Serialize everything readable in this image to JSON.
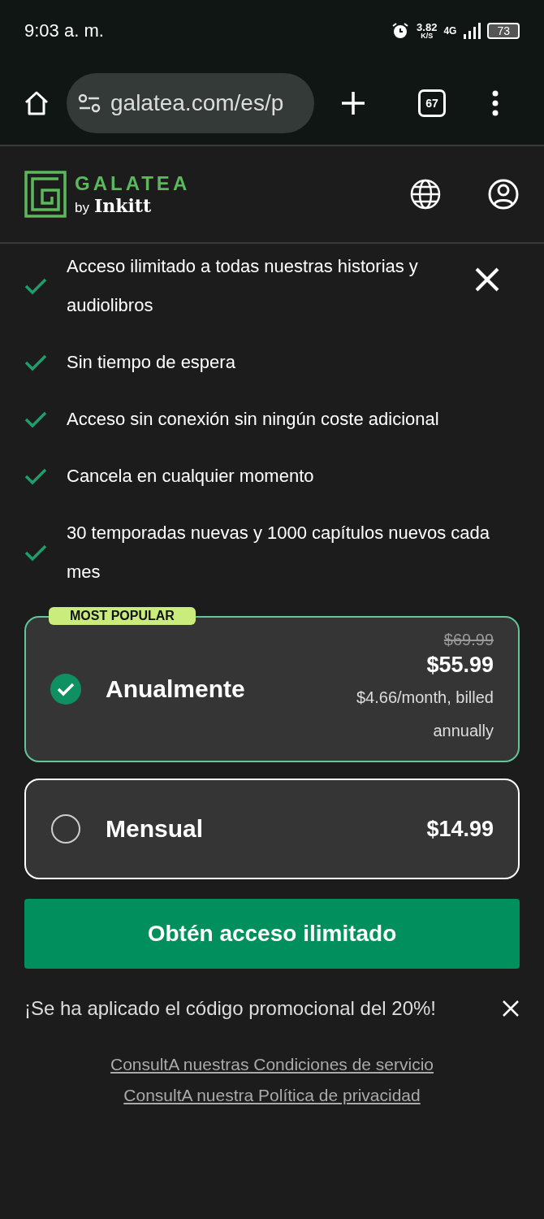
{
  "status_bar": {
    "time": "9:03 a. m.",
    "speed": "3.82",
    "speed_unit": "K/S",
    "network": "4G",
    "battery": "73"
  },
  "browser": {
    "url": "galatea.com/es/p",
    "tab_count": "67"
  },
  "header": {
    "brand": "GALATEA",
    "by": "by",
    "partner": "Inkitt"
  },
  "features": [
    "Acceso ilimitado a todas nuestras historias y audiolibros",
    "Sin tiempo de espera",
    "Acceso sin conexión sin ningún coste adicional",
    "Cancela en cualquier momento",
    "30 temporadas nuevas y 1000 capítulos nuevos cada mes"
  ],
  "plans": [
    {
      "name": "Anualmente",
      "selected": true,
      "badge": "MOST POPULAR",
      "old_price": "$69.99",
      "price": "$55.99",
      "note": "$4.66/month, billed annually"
    },
    {
      "name": "Mensual",
      "selected": false,
      "price": "$14.99"
    }
  ],
  "cta": "Obtén acceso ilimitado",
  "promo": "¡Se ha aplicado el código promocional del 20%!",
  "links": [
    "ConsultA nuestras Condiciones de servicio",
    "ConsultA nuestra Política de privacidad"
  ]
}
